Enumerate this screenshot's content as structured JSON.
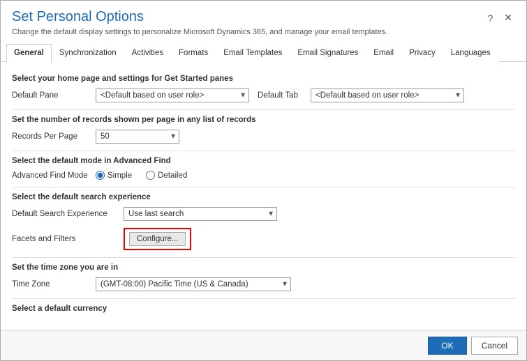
{
  "dialog": {
    "title": "Set Personal Options",
    "subtitle": "Change the default display settings to personalize Microsoft Dynamics 365, and manage your email templates.",
    "help_icon": "?",
    "close_icon": "✕"
  },
  "tabs": [
    {
      "label": "General",
      "active": true
    },
    {
      "label": "Synchronization",
      "active": false
    },
    {
      "label": "Activities",
      "active": false
    },
    {
      "label": "Formats",
      "active": false
    },
    {
      "label": "Email Templates",
      "active": false
    },
    {
      "label": "Email Signatures",
      "active": false
    },
    {
      "label": "Email",
      "active": false
    },
    {
      "label": "Privacy",
      "active": false
    },
    {
      "label": "Languages",
      "active": false
    }
  ],
  "sections": {
    "home_page": {
      "heading": "Select your home page and settings for Get Started panes",
      "default_pane_label": "Default Pane",
      "default_pane_value": "<Default based on user role>",
      "default_tab_label": "Default Tab",
      "default_tab_value": "<Default based on user role>"
    },
    "records_per_page": {
      "heading": "Set the number of records shown per page in any list of records",
      "label": "Records Per Page",
      "value": "50"
    },
    "advanced_find": {
      "heading": "Select the default mode in Advanced Find",
      "label": "Advanced Find Mode",
      "options": [
        {
          "label": "Simple",
          "checked": true
        },
        {
          "label": "Detailed",
          "checked": false
        }
      ]
    },
    "search_experience": {
      "heading": "Select the default search experience",
      "label": "Default Search Experience",
      "value": "Use last search"
    },
    "facets_filters": {
      "label": "Facets and Filters",
      "button_label": "Configure..."
    },
    "time_zone": {
      "heading": "Set the time zone you are in",
      "label": "Time Zone",
      "value": "(GMT-08:00) Pacific Time (US & Canada)"
    },
    "currency": {
      "heading": "Select a default currency"
    }
  },
  "footer": {
    "ok_label": "OK",
    "cancel_label": "Cancel"
  }
}
